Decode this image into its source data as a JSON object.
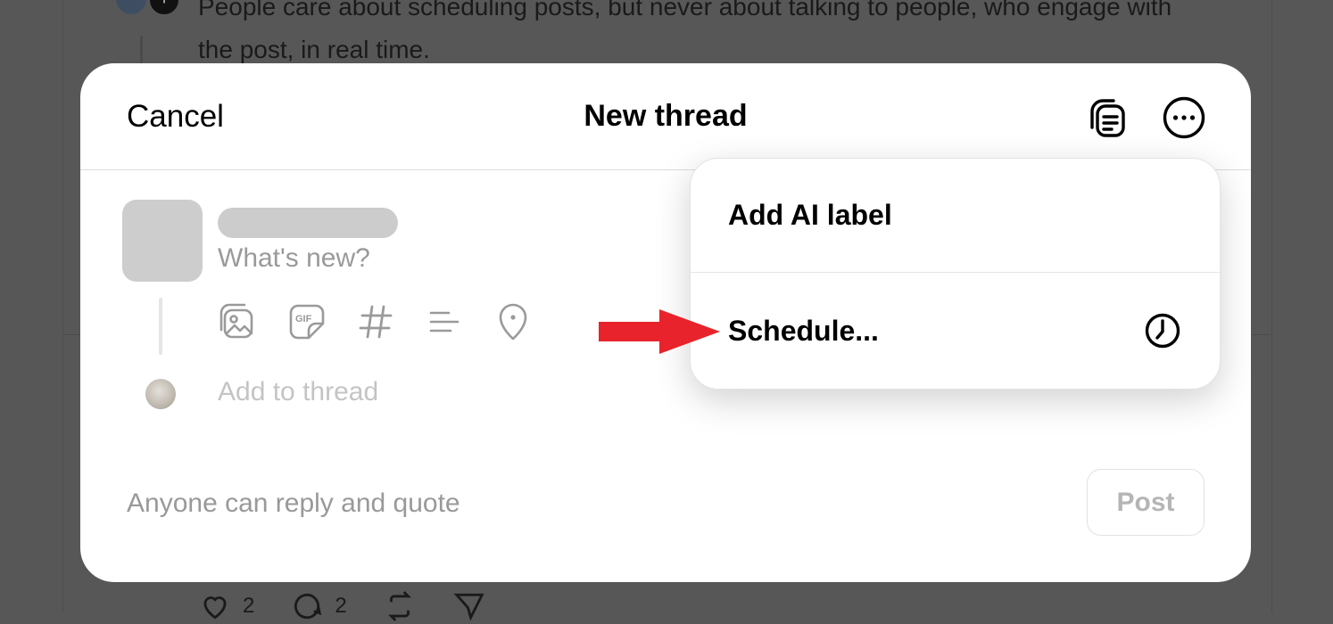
{
  "background": {
    "post_text": "People care about scheduling posts, but never about talking to people, who engage with the post, in real time.",
    "avatar_badge": "+",
    "actions": [
      {
        "icon": "heart-icon",
        "count": "2"
      },
      {
        "icon": "comment-icon",
        "count": "2"
      },
      {
        "icon": "repost-icon",
        "count": ""
      },
      {
        "icon": "send-icon",
        "count": ""
      }
    ]
  },
  "modal": {
    "cancel_label": "Cancel",
    "title": "New thread",
    "header_icons": [
      "drafts-icon",
      "more-icon"
    ],
    "composer": {
      "placeholder": "What's new?",
      "tools": [
        "media-icon",
        "gif-icon",
        "hashtag-icon",
        "poll-icon",
        "location-icon"
      ],
      "add_to_thread": "Add to thread"
    },
    "reply_setting": "Anyone can reply and quote",
    "post_label": "Post"
  },
  "dropdown": {
    "items": [
      {
        "label": "Add AI label",
        "icon": ""
      },
      {
        "label": "Schedule...",
        "icon": "clock-icon"
      }
    ]
  },
  "colors": {
    "overlay": "#575757",
    "annotation_arrow": "#e8232b",
    "placeholder_text": "#9a9a9a"
  }
}
